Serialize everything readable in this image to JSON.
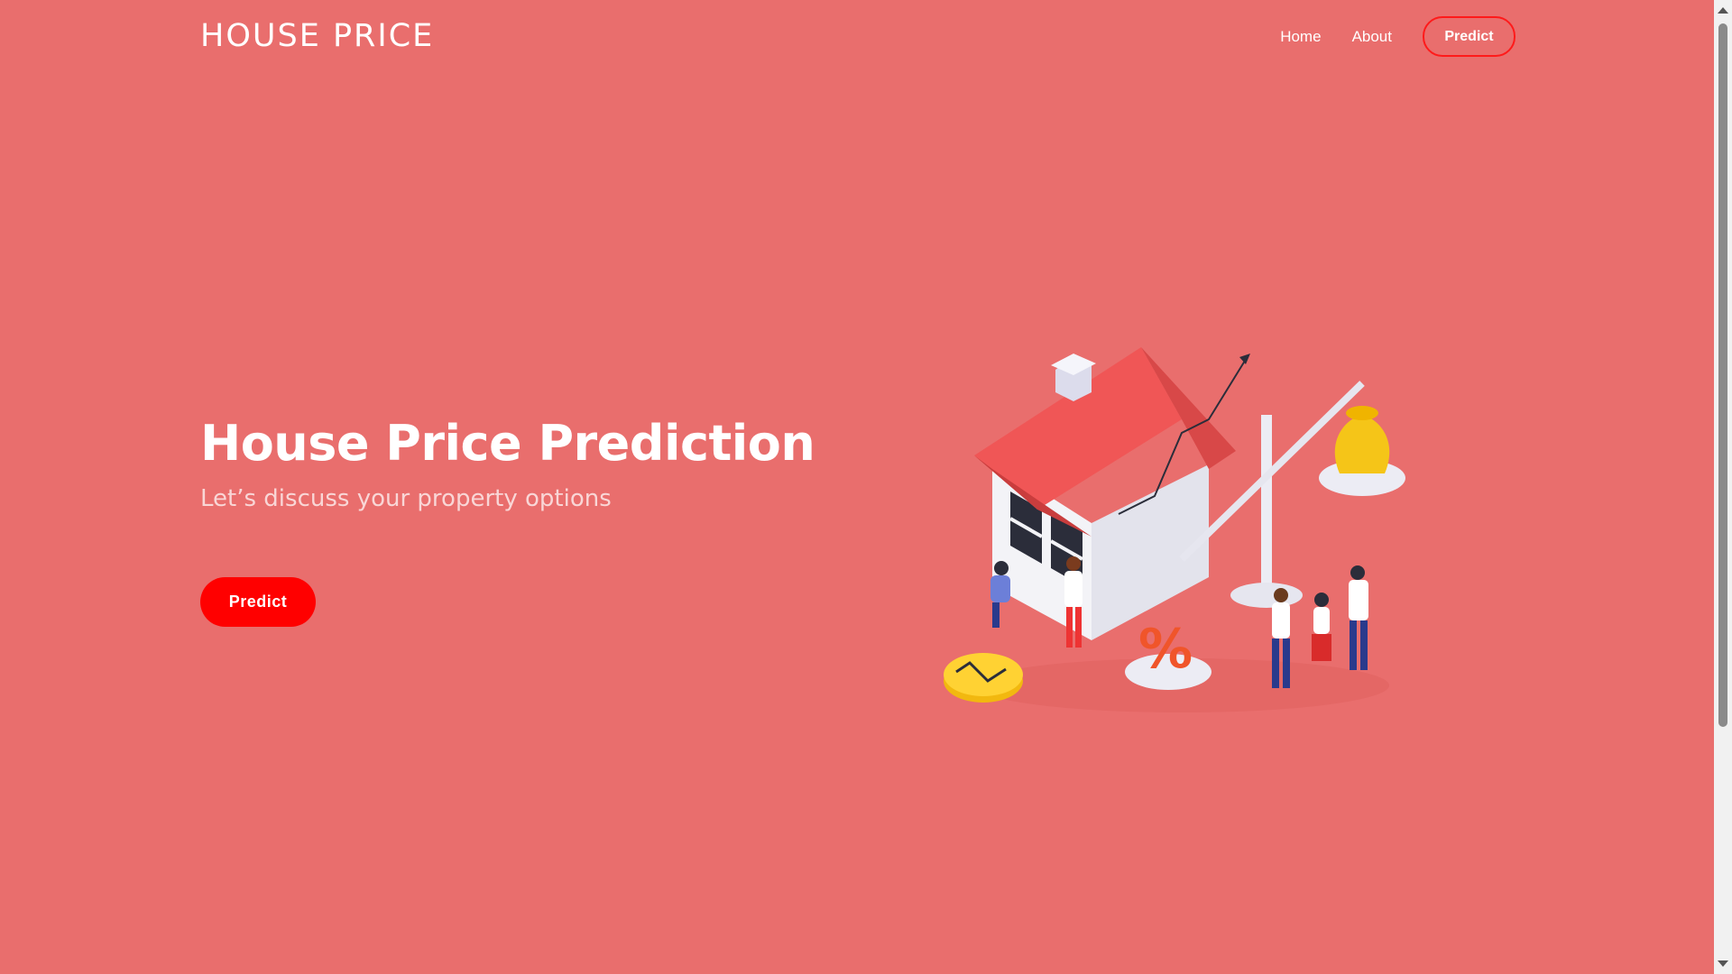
{
  "header": {
    "logo": "HOUSE PRICE",
    "nav": {
      "home": "Home",
      "about": "About",
      "predict": "Predict"
    }
  },
  "hero": {
    "title": "House Price Prediction",
    "subtitle": "Let’s discuss your property options",
    "button": "Predict"
  },
  "colors": {
    "background": "#e96e6d",
    "accent": "#ff0000",
    "text": "#ffffff"
  },
  "icons": [
    "house-illustration",
    "money-bag-icon",
    "coin-icon",
    "percent-icon",
    "scale-icon"
  ]
}
